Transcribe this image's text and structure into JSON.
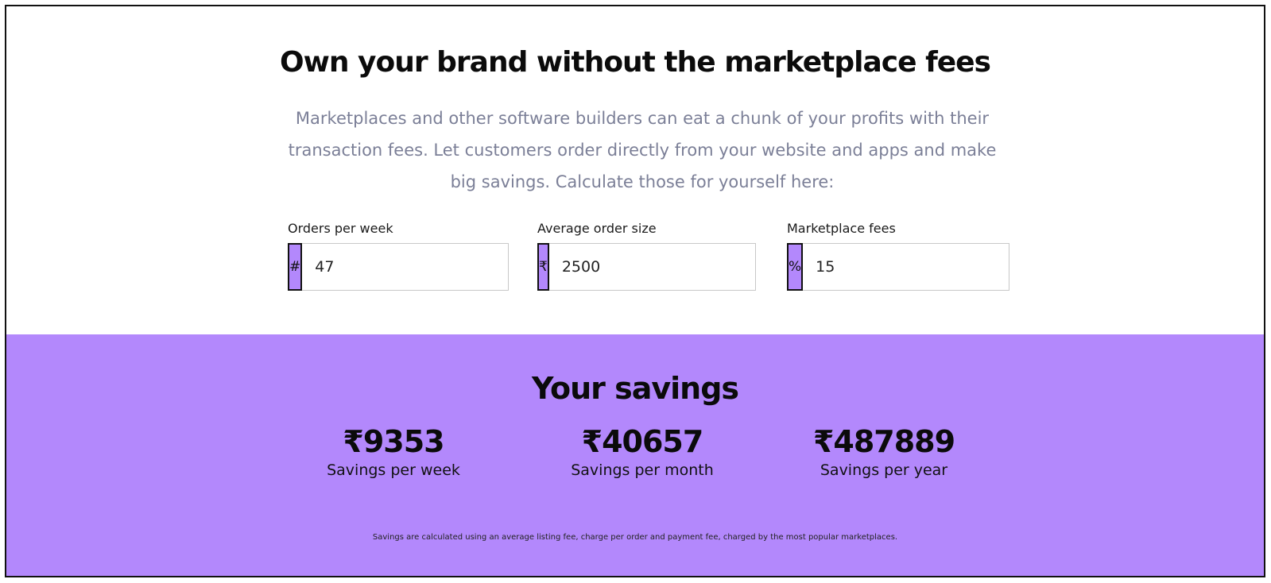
{
  "header": {
    "title": "Own your brand without the marketplace fees",
    "subtitle": "Marketplaces and other software builders can eat a chunk of your profits with their transaction fees. Let customers order directly from your website and apps and make big savings. Calculate those for yourself here:"
  },
  "calculator": {
    "fields": [
      {
        "label": "Orders per week",
        "prefix": "#",
        "value": "47"
      },
      {
        "label": "Average order size",
        "prefix": "₹",
        "value": "2500"
      },
      {
        "label": "Marketplace fees",
        "prefix": "%",
        "value": "15"
      }
    ]
  },
  "savings": {
    "title": "Your savings",
    "items": [
      {
        "value": "₹9353",
        "label": "Savings per week"
      },
      {
        "value": "₹40657",
        "label": "Savings per month"
      },
      {
        "value": "₹487889",
        "label": "Savings per year"
      }
    ],
    "disclaimer": "Savings are calculated using an average listing fee, charge per order and payment fee, charged by the most popular marketplaces."
  },
  "colors": {
    "accent": "#b388fc",
    "heading": "#0b0b0b",
    "subtitle": "#7b7f97"
  }
}
